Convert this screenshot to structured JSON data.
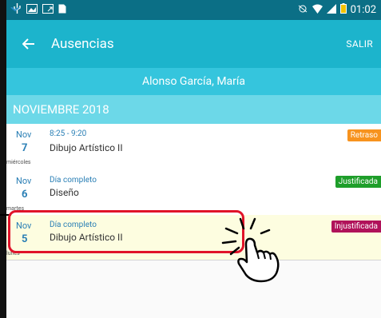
{
  "statusbar": {
    "time": "01:02"
  },
  "appbar": {
    "back_icon": "arrow-left-icon",
    "title": "Ausencias",
    "salir": "SALIR"
  },
  "student": "Alonso García, María",
  "month": "NOVIEMBRE 2018",
  "entries": [
    {
      "month": "Nov",
      "day": "7",
      "weekday": "miércoles",
      "time": "8:25 - 9:20",
      "subject": "Dibujo Artístico II",
      "status": "Retraso",
      "color": "#f7931e"
    },
    {
      "month": "Nov",
      "day": "6",
      "weekday": "martes",
      "time": "Día completo",
      "subject": "Diseño",
      "status": "Justificada",
      "color": "#1e9e2a"
    },
    {
      "month": "Nov",
      "day": "5",
      "weekday": "lunes",
      "time": "Día completo",
      "subject": "Dibujo Artístico II",
      "status": "Injustificada",
      "color": "#b0125a"
    }
  ]
}
